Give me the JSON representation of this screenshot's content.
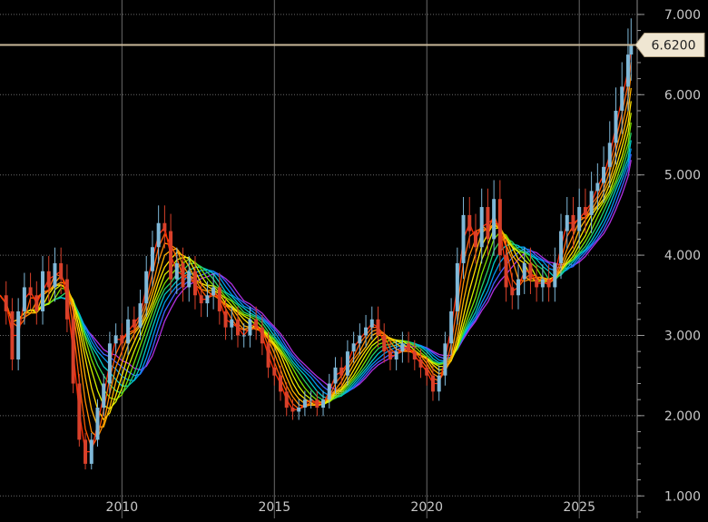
{
  "chart_data": {
    "type": "line",
    "subtype": "candlestick with rainbow moving-average ribbon",
    "title": "",
    "xlabel": "",
    "ylabel": "",
    "xlim": [
      2006.0,
      2026.9
    ],
    "ylim": [
      0.72,
      7.18
    ],
    "y_axis_position": "right",
    "y_ticks": [
      {
        "value": 1.0,
        "label": "1.000"
      },
      {
        "value": 2.0,
        "label": "2.000"
      },
      {
        "value": 3.0,
        "label": "3.000"
      },
      {
        "value": 4.0,
        "label": "4.000"
      },
      {
        "value": 5.0,
        "label": "5.000"
      },
      {
        "value": 6.0,
        "label": "6.000"
      },
      {
        "value": 7.0,
        "label": "7.000"
      }
    ],
    "x_ticks": [
      {
        "value": 2010,
        "label": "2010"
      },
      {
        "value": 2015,
        "label": "2015"
      },
      {
        "value": 2020,
        "label": "2020"
      },
      {
        "value": 2025,
        "label": "2025"
      }
    ],
    "grid": true,
    "last_price": {
      "value": 6.62,
      "label": "6.6200",
      "line_color": "#c9b89a",
      "label_bg": "#efe6d2"
    },
    "candle_colors": {
      "up": "#7fb8d8",
      "down": "#d8402a"
    },
    "price_series": {
      "name": "",
      "x": [
        2006.0,
        2006.2,
        2006.4,
        2006.6,
        2006.8,
        2007.0,
        2007.2,
        2007.4,
        2007.6,
        2007.8,
        2008.0,
        2008.2,
        2008.4,
        2008.6,
        2008.8,
        2009.0,
        2009.2,
        2009.4,
        2009.6,
        2009.8,
        2010.0,
        2010.2,
        2010.4,
        2010.6,
        2010.8,
        2011.0,
        2011.2,
        2011.4,
        2011.6,
        2011.8,
        2012.0,
        2012.2,
        2012.4,
        2012.6,
        2012.8,
        2013.0,
        2013.2,
        2013.4,
        2013.6,
        2013.8,
        2014.0,
        2014.2,
        2014.4,
        2014.6,
        2014.8,
        2015.0,
        2015.2,
        2015.4,
        2015.6,
        2015.8,
        2016.0,
        2016.2,
        2016.4,
        2016.6,
        2016.8,
        2017.0,
        2017.2,
        2017.4,
        2017.6,
        2017.8,
        2018.0,
        2018.2,
        2018.4,
        2018.6,
        2018.8,
        2019.0,
        2019.2,
        2019.4,
        2019.6,
        2019.8,
        2020.0,
        2020.2,
        2020.4,
        2020.6,
        2020.8,
        2021.0,
        2021.2,
        2021.4,
        2021.6,
        2021.8,
        2022.0,
        2022.2,
        2022.4,
        2022.6,
        2022.8,
        2023.0,
        2023.2,
        2023.4,
        2023.6,
        2023.8,
        2024.0,
        2024.2,
        2024.4,
        2024.6,
        2024.8,
        2025.0,
        2025.2,
        2025.4,
        2025.6,
        2025.8,
        2026.0,
        2026.2,
        2026.4,
        2026.6,
        2026.7
      ],
      "y": [
        3.5,
        3.3,
        2.7,
        3.3,
        3.6,
        3.5,
        3.3,
        3.8,
        3.6,
        3.9,
        3.7,
        3.2,
        2.4,
        1.7,
        1.4,
        1.7,
        2.1,
        2.4,
        2.9,
        3.0,
        2.9,
        3.2,
        3.1,
        3.4,
        3.8,
        4.1,
        4.4,
        4.3,
        3.7,
        3.9,
        3.6,
        3.8,
        3.5,
        3.4,
        3.5,
        3.6,
        3.3,
        3.1,
        3.2,
        3.0,
        3.0,
        3.2,
        3.1,
        2.9,
        2.6,
        2.5,
        2.3,
        2.1,
        2.05,
        2.1,
        2.2,
        2.2,
        2.1,
        2.2,
        2.4,
        2.6,
        2.5,
        2.8,
        2.9,
        3.0,
        3.1,
        3.2,
        3.0,
        2.8,
        2.7,
        2.8,
        2.9,
        2.8,
        2.7,
        2.6,
        2.5,
        2.3,
        2.5,
        2.9,
        3.3,
        3.9,
        4.5,
        4.3,
        4.1,
        4.6,
        4.2,
        4.7,
        4.0,
        3.6,
        3.5,
        3.7,
        3.9,
        3.7,
        3.6,
        3.7,
        3.6,
        3.9,
        4.3,
        4.5,
        4.3,
        4.6,
        4.5,
        4.8,
        4.9,
        5.1,
        5.4,
        5.8,
        6.1,
        6.5,
        6.62
      ]
    },
    "ribbon_series": {
      "note_lengths": [
        2,
        3,
        4,
        5,
        6,
        7,
        8,
        9,
        10,
        11,
        12,
        13
      ],
      "colors": [
        "#ff2a00",
        "#ff5a00",
        "#ff8c00",
        "#ffb300",
        "#ffe000",
        "#d4f000",
        "#7fe000",
        "#28d060",
        "#00c8c8",
        "#0096f0",
        "#4060ff",
        "#b030e0"
      ]
    }
  }
}
